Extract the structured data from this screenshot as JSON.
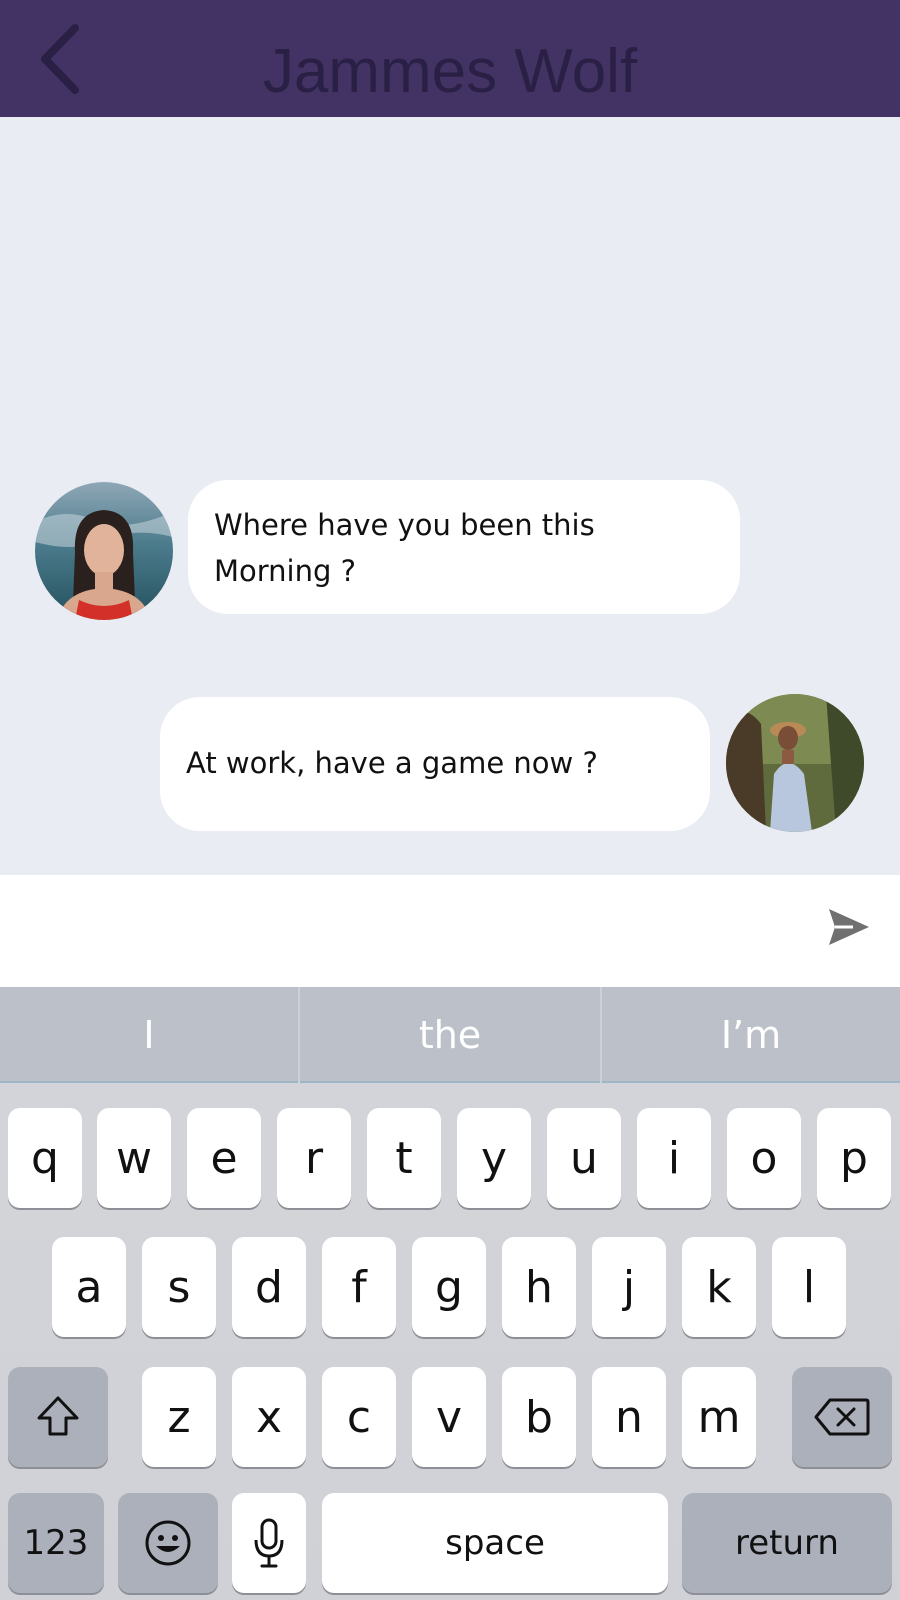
{
  "header": {
    "title": "Jammes Wolf",
    "back_icon": "chevron-left-icon"
  },
  "messages": [
    {
      "side": "left",
      "text": "Where have you been this Morning ?",
      "avatar_icon": "woman-avatar"
    },
    {
      "side": "right",
      "text": "At work, have a game now ?",
      "avatar_icon": "woman-avatar"
    }
  ],
  "composer": {
    "value": "",
    "placeholder": "",
    "send_icon": "send-icon"
  },
  "keyboard": {
    "suggestions": [
      "I",
      "the",
      "I’m"
    ],
    "row1": [
      "q",
      "w",
      "e",
      "r",
      "t",
      "y",
      "u",
      "i",
      "o",
      "p"
    ],
    "row2": [
      "a",
      "s",
      "d",
      "f",
      "g",
      "h",
      "j",
      "k",
      "l"
    ],
    "row3": [
      "z",
      "x",
      "c",
      "v",
      "b",
      "n",
      "m"
    ],
    "numbers_label": "123",
    "space_label": "space",
    "return_label": "return"
  },
  "colors": {
    "header": "#433364",
    "chat_bg": "#eaecf3",
    "bubble": "#ffffff",
    "keyboard": "#d3d5da",
    "suggestion_bar": "#bcc1c9"
  }
}
